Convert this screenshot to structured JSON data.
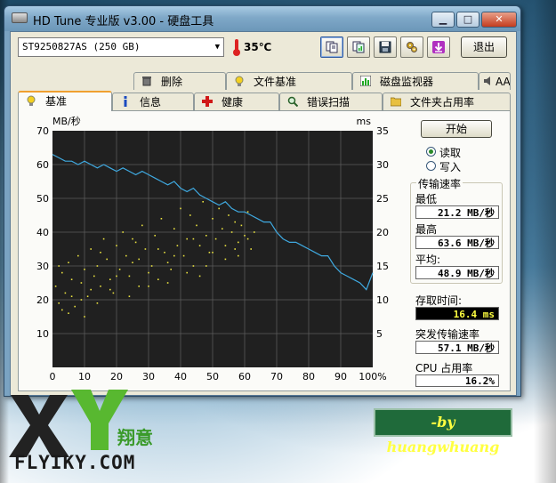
{
  "window": {
    "title": "HD Tune 专业版 v3.00 - 硬盘工具",
    "minimize": "▁",
    "maximize": "□",
    "close": "✕"
  },
  "toolbar": {
    "drive": "ST9250827AS (250 GB)",
    "temperature": "35℃",
    "exit_label": "退出",
    "buttons": [
      "copy-info-icon",
      "copy-chart-icon",
      "save-icon",
      "settings-icon",
      "download-icon"
    ]
  },
  "tabs_top": [
    {
      "label": "删除",
      "icon": "trash-icon"
    },
    {
      "label": "文件基准",
      "icon": "file-benchmark-icon"
    },
    {
      "label": "磁盘监视器",
      "icon": "disk-monitor-icon"
    },
    {
      "label": "AAM",
      "icon": "speaker-icon"
    }
  ],
  "tabs_bottom": [
    {
      "label": "基准",
      "icon": "info-bulb-icon",
      "selected": true
    },
    {
      "label": "信息",
      "icon": "info-icon"
    },
    {
      "label": "健康",
      "icon": "health-cross-icon"
    },
    {
      "label": "错误扫描",
      "icon": "magnifier-icon"
    },
    {
      "label": "文件夹占用率",
      "icon": "folder-icon"
    }
  ],
  "panel": {
    "start_label": "开始",
    "read_label": "读取",
    "write_label": "写入",
    "mode_selected": "read",
    "transfer_title": "传输速率",
    "min_label": "最低",
    "min_value": "21.2 MB/秒",
    "max_label": "最高",
    "max_value": "63.6 MB/秒",
    "avg_label": "平均:",
    "avg_value": "48.9 MB/秒",
    "access_label": "存取时间:",
    "access_value": "16.4 ms",
    "burst_label": "突发传输速率",
    "burst_value": "57.1 MB/秒",
    "cpu_label": "CPU 占用率",
    "cpu_value": "16.2%"
  },
  "chart_data": {
    "type": "line",
    "left_axis_label": "MB/秒",
    "right_axis_label": "ms",
    "left_ylim": [
      0,
      70
    ],
    "right_ylim": [
      0,
      35
    ],
    "left_ticks": [
      "70",
      "60",
      "50",
      "40",
      "30",
      "20",
      "10"
    ],
    "right_ticks": [
      "35",
      "30",
      "25",
      "20",
      "15",
      "10",
      "5"
    ],
    "x_ticks": [
      "0",
      "10",
      "20",
      "30",
      "40",
      "50",
      "60",
      "70",
      "80",
      "90",
      "100%"
    ],
    "xlim": [
      0,
      100
    ],
    "grid": true,
    "colors": {
      "background": "#202020",
      "grid": "#5a5a5a",
      "transfer": "#3fa9e0",
      "access": "#e8e040"
    },
    "series": [
      {
        "values_x": [
          0,
          2,
          4,
          6,
          8,
          10,
          12,
          14,
          16,
          18,
          20,
          22,
          24,
          26,
          28,
          30,
          32,
          34,
          36,
          38,
          40,
          42,
          44,
          46,
          48,
          50,
          52,
          54,
          56,
          58,
          60,
          62,
          64,
          66,
          68,
          70,
          72,
          74,
          76,
          78,
          80,
          82,
          84,
          86,
          88,
          90,
          92,
          94,
          96,
          98,
          100
        ],
        "values_y": [
          63,
          62,
          61,
          61,
          60,
          61,
          60,
          59,
          60,
          59,
          58,
          59,
          58,
          57,
          58,
          57,
          56,
          55,
          54,
          55,
          53,
          52,
          53,
          51,
          50,
          49,
          48,
          49,
          47,
          46,
          46,
          45,
          44,
          43,
          43,
          40,
          38,
          37,
          37,
          36,
          35,
          34,
          33,
          33,
          30,
          28,
          27,
          26,
          25,
          23,
          28
        ]
      }
    ],
    "access_points": [
      [
        1,
        24
      ],
      [
        2,
        19
      ],
      [
        3,
        28
      ],
      [
        4,
        22
      ],
      [
        5,
        31
      ],
      [
        6,
        26
      ],
      [
        7,
        18
      ],
      [
        8,
        33
      ],
      [
        9,
        25
      ],
      [
        10,
        29
      ],
      [
        11,
        21
      ],
      [
        12,
        35
      ],
      [
        13,
        27
      ],
      [
        14,
        30
      ],
      [
        15,
        24
      ],
      [
        16,
        38
      ],
      [
        17,
        32
      ],
      [
        18,
        26
      ],
      [
        19,
        22
      ],
      [
        20,
        36
      ],
      [
        21,
        29
      ],
      [
        22,
        40
      ],
      [
        23,
        33
      ],
      [
        24,
        27
      ],
      [
        25,
        31
      ],
      [
        26,
        37
      ],
      [
        27,
        24
      ],
      [
        28,
        42
      ],
      [
        29,
        35
      ],
      [
        30,
        28
      ],
      [
        31,
        30
      ],
      [
        32,
        39
      ],
      [
        33,
        26
      ],
      [
        34,
        44
      ],
      [
        35,
        34
      ],
      [
        36,
        31
      ],
      [
        37,
        29
      ],
      [
        38,
        41
      ],
      [
        39,
        36
      ],
      [
        40,
        47
      ],
      [
        41,
        33
      ],
      [
        42,
        38
      ],
      [
        43,
        45
      ],
      [
        44,
        30
      ],
      [
        45,
        42
      ],
      [
        46,
        36
      ],
      [
        47,
        49
      ],
      [
        48,
        39
      ],
      [
        49,
        34
      ],
      [
        50,
        44
      ],
      [
        51,
        38
      ],
      [
        52,
        47
      ],
      [
        53,
        41
      ],
      [
        54,
        36
      ],
      [
        55,
        45
      ],
      [
        56,
        40
      ],
      [
        57,
        43
      ],
      [
        58,
        37
      ],
      [
        59,
        42
      ],
      [
        60,
        39
      ],
      [
        61,
        46
      ],
      [
        62,
        35
      ],
      [
        63,
        40
      ],
      [
        3,
        17
      ],
      [
        6,
        21
      ],
      [
        9,
        20
      ],
      [
        14,
        19
      ],
      [
        18,
        23
      ],
      [
        24,
        21
      ],
      [
        30,
        24
      ],
      [
        36,
        25
      ],
      [
        42,
        28
      ],
      [
        48,
        30
      ],
      [
        54,
        32
      ],
      [
        58,
        33
      ],
      [
        2,
        30
      ],
      [
        5,
        16
      ],
      [
        10,
        15
      ],
      [
        15,
        34
      ],
      [
        20,
        27
      ],
      [
        25,
        38
      ],
      [
        33,
        35
      ],
      [
        38,
        33
      ],
      [
        44,
        38
      ],
      [
        50,
        34
      ],
      [
        57,
        35
      ],
      [
        61,
        38
      ],
      [
        12,
        23
      ],
      [
        27,
        32
      ],
      [
        46,
        27
      ]
    ]
  }
}
